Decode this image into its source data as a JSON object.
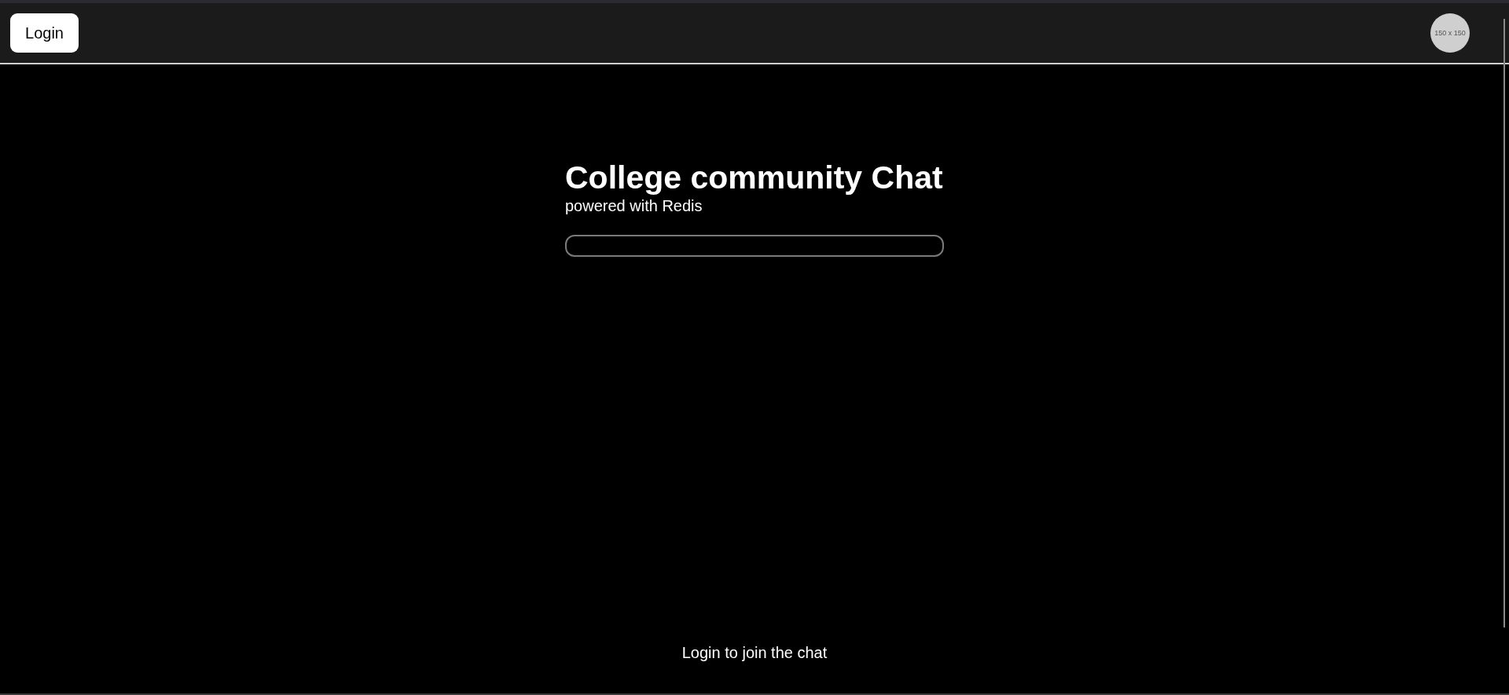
{
  "header": {
    "login_button": "Login",
    "avatar": {
      "text": "150 x 150"
    }
  },
  "main": {
    "title": "College community Chat",
    "subtitle": "powered with Redis"
  },
  "footer": {
    "text": "Login to join the chat"
  }
}
